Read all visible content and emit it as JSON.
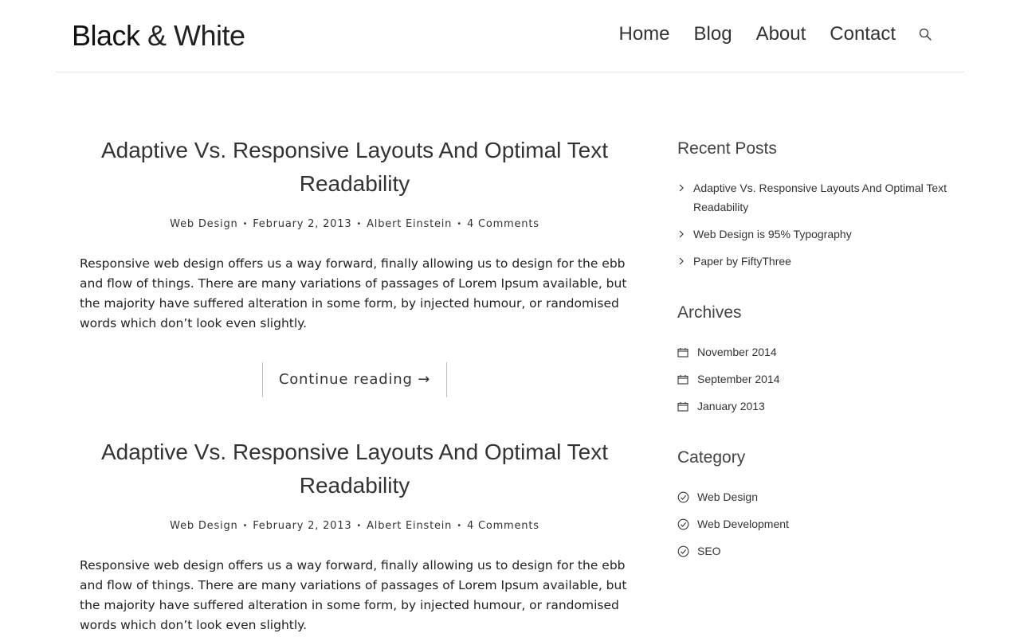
{
  "header": {
    "logo_bold": "Black",
    "logo_light": "& White",
    "nav": [
      "Home",
      "Blog",
      "About",
      "Contact"
    ]
  },
  "posts": [
    {
      "title": "Adaptive Vs. Responsive Layouts And Optimal Text Readability",
      "category": "Web Design",
      "date": "February 2, 2013",
      "author": "Albert Einstein",
      "comments": "4 Comments",
      "excerpt": "Responsive web design offers us a way forward, finally allowing us to design for the ebb and flow of things. There are many variations of passages of Lorem Ipsum available, but the majority have suffered alteration in some form, by injected humour, or randomised words which don’t look even slightly.",
      "more": "Continue reading →"
    },
    {
      "title": "Adaptive Vs. Responsive Layouts And Optimal Text Readability",
      "category": "Web Design",
      "date": "February 2, 2013",
      "author": "Albert Einstein",
      "comments": "4 Comments",
      "excerpt": "Responsive web design offers us a way forward, finally allowing us to design for the ebb and flow of things. There are many variations of passages of Lorem Ipsum available, but the majority have suffered alteration in some form, by injected humour, or randomised words which don’t look even slightly."
    }
  ],
  "sidebar": {
    "recent": {
      "title": "Recent Posts",
      "items": [
        "Adaptive Vs. Responsive Layouts And Optimal Text Readability",
        "Web Design is 95% Typography",
        "Paper by FiftyThree"
      ]
    },
    "archives": {
      "title": "Archives",
      "items": [
        "November 2014",
        "September 2014",
        "January 2013"
      ]
    },
    "category": {
      "title": "Category",
      "items": [
        "Web Design",
        "Web Development",
        "SEO"
      ]
    }
  }
}
